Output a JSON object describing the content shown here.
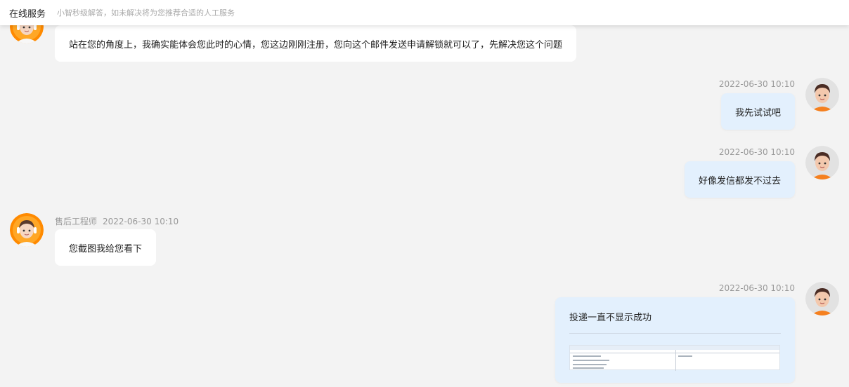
{
  "header": {
    "title": "在线服务",
    "subtitle": "小智秒级解答，如未解决将为您推荐合适的人工服务"
  },
  "messages": [
    {
      "side": "left",
      "text": "站在您的角度上，我确实能体会您此时的心情，您这边刚刚注册，您向这个邮件发送申请解锁就可以了，先解决您这个问题"
    },
    {
      "side": "right",
      "time": "2022-06-30 10:10",
      "text": "我先试试吧"
    },
    {
      "side": "right",
      "time": "2022-06-30 10:10",
      "text": "好像发信都发不过去"
    },
    {
      "side": "left",
      "sender": "售后工程师",
      "time": "2022-06-30 10:10",
      "text": "您截图我给您看下"
    },
    {
      "side": "right",
      "time": "2022-06-30 10:10",
      "text": "投递一直不显示成功",
      "attachment": "screenshot-thumbnail"
    }
  ],
  "colors": {
    "background": "#f3f3f3",
    "user_bubble": "#e3f0fd",
    "agent_bubble": "#ffffff",
    "agent_avatar_ring": "#ff8a00",
    "user_shirt": "#f5801f"
  }
}
